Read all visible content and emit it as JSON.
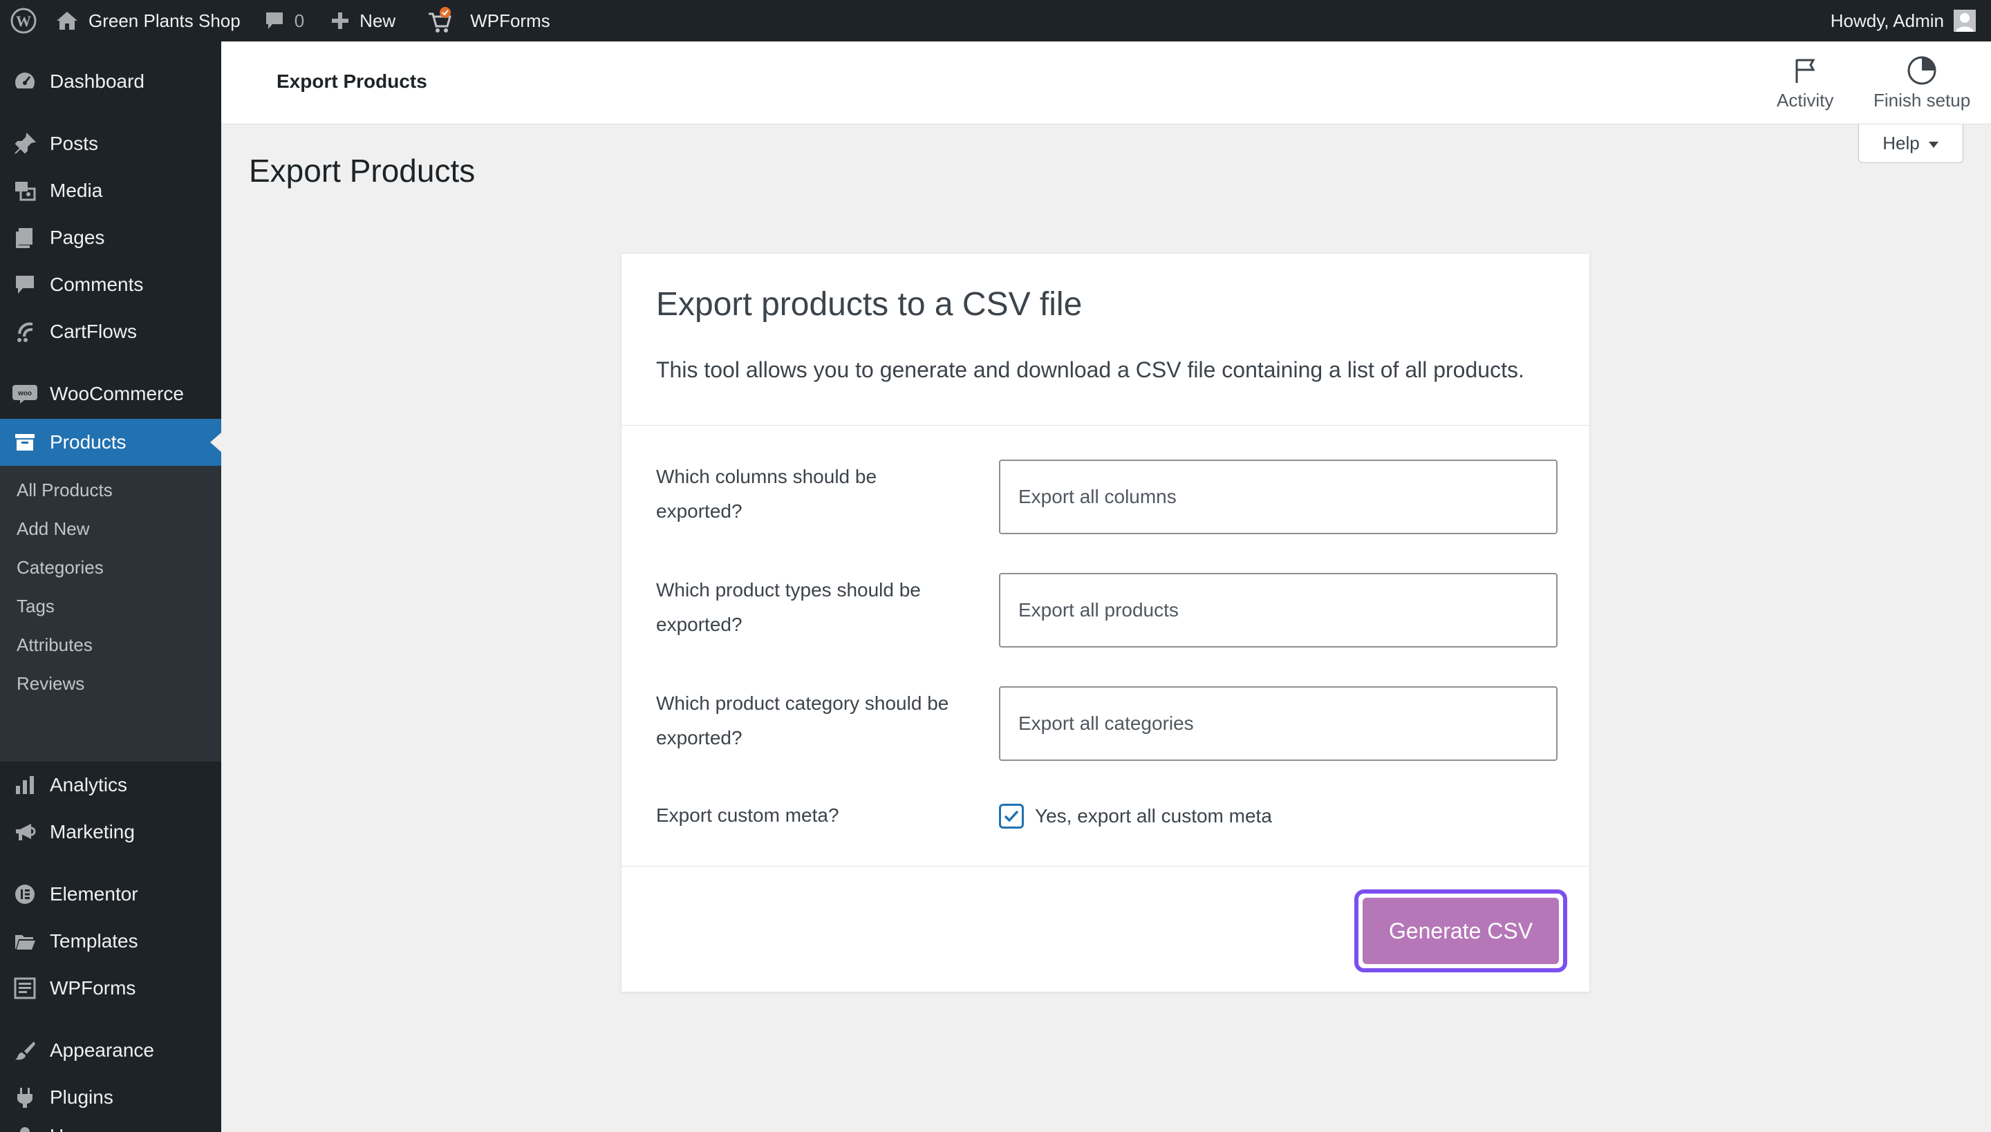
{
  "admin_bar": {
    "site_name": "Green Plants Shop",
    "comments_count": "0",
    "new_label": "New",
    "wpforms_label": "WPForms",
    "howdy": "Howdy, Admin"
  },
  "sidebar": {
    "items": [
      {
        "label": "Dashboard",
        "icon": "dashboard-icon"
      },
      {
        "label": "Posts",
        "icon": "pin-icon"
      },
      {
        "label": "Media",
        "icon": "media-icon"
      },
      {
        "label": "Pages",
        "icon": "pages-icon"
      },
      {
        "label": "Comments",
        "icon": "comment-icon"
      },
      {
        "label": "CartFlows",
        "icon": "cartflows-icon"
      },
      {
        "label": "WooCommerce",
        "icon": "woo-icon"
      },
      {
        "label": "Products",
        "icon": "archive-icon"
      },
      {
        "label": "Analytics",
        "icon": "bar-chart-icon"
      },
      {
        "label": "Marketing",
        "icon": "megaphone-icon"
      },
      {
        "label": "Elementor",
        "icon": "elementor-icon"
      },
      {
        "label": "Templates",
        "icon": "folder-icon"
      },
      {
        "label": "WPForms",
        "icon": "form-icon"
      },
      {
        "label": "Appearance",
        "icon": "brush-icon"
      },
      {
        "label": "Plugins",
        "icon": "plug-icon"
      },
      {
        "label": "Users",
        "icon": "user-icon"
      }
    ],
    "submenu": [
      "All Products",
      "Add New",
      "Categories",
      "Tags",
      "Attributes",
      "Reviews"
    ]
  },
  "header": {
    "title": "Export Products",
    "activity_label": "Activity",
    "finish_setup_label": "Finish setup",
    "help_label": "Help"
  },
  "page": {
    "title": "Export Products"
  },
  "card": {
    "title": "Export products to a CSV file",
    "description": "This tool allows you to generate and download a CSV file containing a list of all products.",
    "fields": [
      {
        "label_line1": "Which columns should be",
        "label_line2": "exported?",
        "value": "Export all columns"
      },
      {
        "label_line1": "Which product types should be",
        "label_line2": "exported?",
        "value": "Export all products"
      },
      {
        "label_line1": "Which product category should be",
        "label_line2": "exported?",
        "value": "Export all categories"
      }
    ],
    "meta_label": "Export custom meta?",
    "meta_checkbox_label": "Yes, export all custom meta",
    "meta_checked": true,
    "generate_label": "Generate CSV"
  },
  "colors": {
    "admin_bar_bg": "#1d2327",
    "active_menu": "#2271b1",
    "generate_button": "#b577b8",
    "focus_ring": "#7b4ff0"
  }
}
